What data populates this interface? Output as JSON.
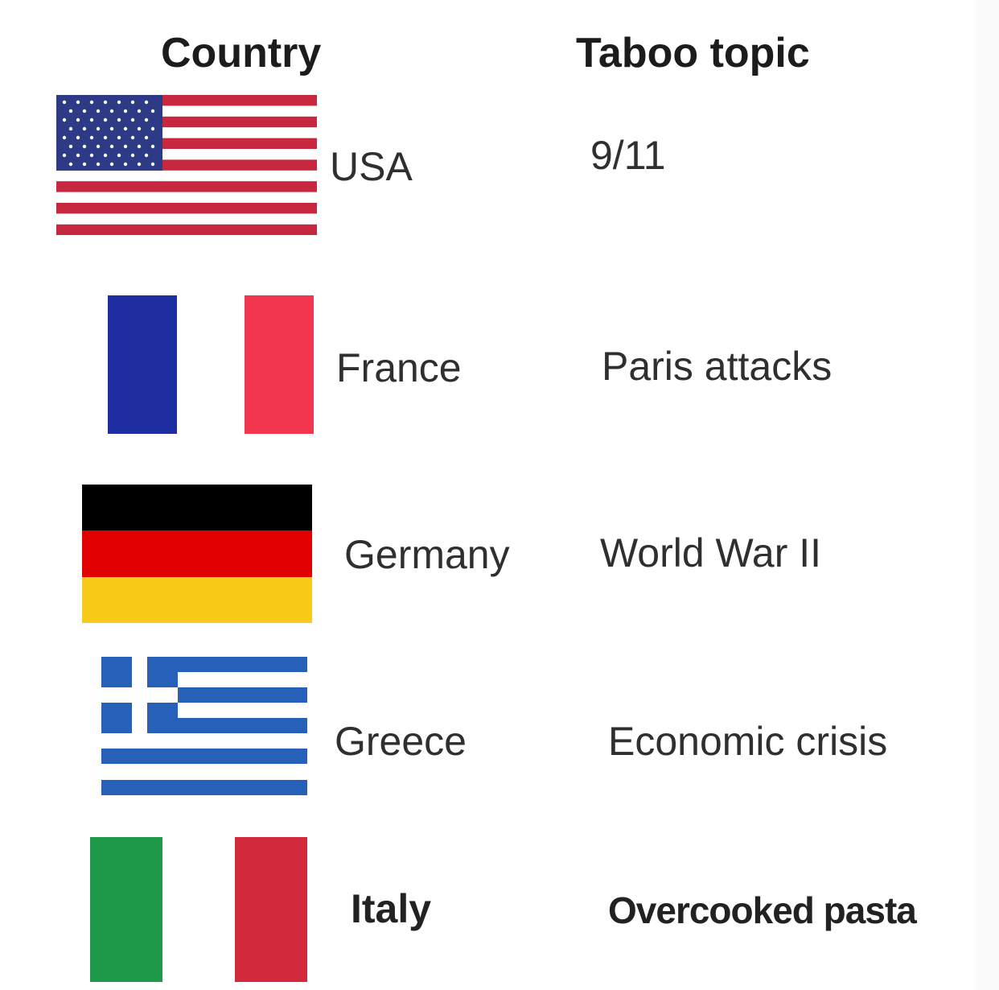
{
  "headers": {
    "country": "Country",
    "topic": "Taboo topic"
  },
  "rows": [
    {
      "country": "USA",
      "topic": "9/11",
      "flag_icon": "usa-flag-icon"
    },
    {
      "country": "France",
      "topic": "Paris attacks",
      "flag_icon": "france-flag-icon"
    },
    {
      "country": "Germany",
      "topic": "World War II",
      "flag_icon": "germany-flag-icon"
    },
    {
      "country": "Greece",
      "topic": "Economic crisis",
      "flag_icon": "greece-flag-icon"
    },
    {
      "country": "Italy",
      "topic": "Overcooked pasta",
      "flag_icon": "italy-flag-icon"
    }
  ],
  "colors": {
    "usa_red": "#c8283f",
    "usa_blue": "#2d3a86",
    "france_blue": "#1e2ea1",
    "france_red": "#f23650",
    "germany_black": "#000000",
    "germany_red": "#e00000",
    "germany_gold": "#f7cb18",
    "greece_blue": "#2660b8",
    "italy_green": "#1f9a48",
    "italy_red": "#d22a3c"
  }
}
